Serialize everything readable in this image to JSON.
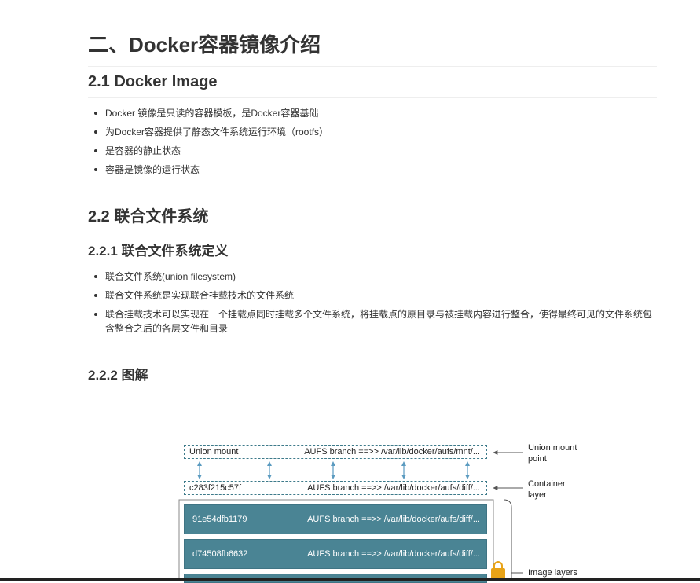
{
  "heading_main": "二、Docker容器镜像介绍",
  "section_2_1": {
    "title": "2.1 Docker Image",
    "items": [
      "Docker 镜像是只读的容器模板，是Docker容器基础",
      "为Docker容器提供了静态文件系统运行环境（rootfs）",
      "是容器的静止状态",
      "容器是镜像的运行状态"
    ]
  },
  "section_2_2": {
    "title": "2.2 联合文件系统",
    "sub1": {
      "title": "2.2.1 联合文件系统定义",
      "items": [
        "联合文件系统(union filesystem)",
        "联合文件系统是实现联合挂载技术的文件系统",
        "联合挂载技术可以实现在一个挂载点同时挂载多个文件系统，将挂载点的原目录与被挂载内容进行整合，使得最终可见的文件系统包含整合之后的各层文件和目录"
      ]
    },
    "sub2": {
      "title": "2.2.2 图解"
    }
  },
  "diagram": {
    "union_mount": {
      "left": "Union mount",
      "right": "AUFS branch ==>> /var/lib/docker/aufs/mnt/..."
    },
    "container": {
      "left": "c283f215c57f",
      "right": "AUFS branch ==>> /var/lib/docker/aufs/diff/..."
    },
    "layers": [
      {
        "left": "91e54dfb1179",
        "right": "AUFS branch ==>> /var/lib/docker/aufs/diff/..."
      },
      {
        "left": "d74508fb6632",
        "right": "AUFS branch ==>> /var/lib/docker/aufs/diff/..."
      }
    ],
    "callouts": {
      "union": "Union mount\npoint",
      "container": "Container\nlayer",
      "image": "Image layers"
    },
    "colors": {
      "layer_fill": "#4a8494",
      "border": "#3d7a8a",
      "lock": "#e8a317"
    }
  }
}
